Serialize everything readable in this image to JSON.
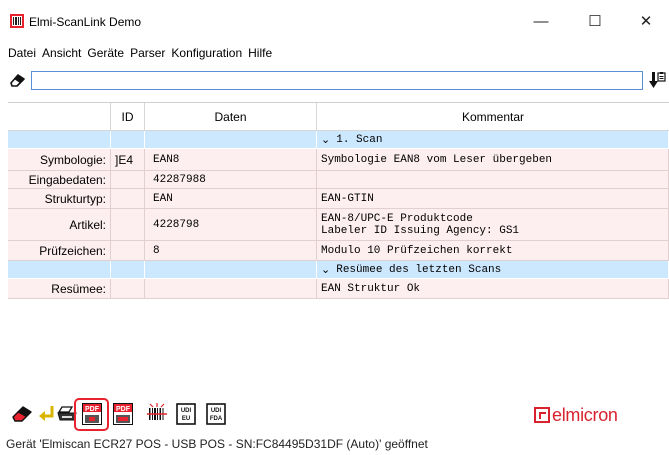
{
  "window": {
    "title": "Elmi-ScanLink Demo",
    "controls": {
      "minimize": "—",
      "maximize": "☐",
      "close": "✕"
    }
  },
  "menu": [
    "Datei",
    "Ansicht",
    "Geräte",
    "Parser",
    "Konfiguration",
    "Hilfe"
  ],
  "search": {
    "value": "",
    "placeholder": ""
  },
  "table": {
    "columns": [
      "",
      "ID",
      "Daten",
      "Kommentar"
    ],
    "rows": [
      {
        "kind": "section",
        "label": "",
        "id": "",
        "data": "",
        "comment": "1. Scan"
      },
      {
        "kind": "data",
        "label": "Symbologie:",
        "id": "]E4",
        "data": "EAN8",
        "comment": "Symbologie EAN8 vom Leser übergeben"
      },
      {
        "kind": "data",
        "label": "Eingabedaten:",
        "id": "",
        "data": "42287988",
        "comment": ""
      },
      {
        "kind": "data",
        "label": "Strukturtyp:",
        "id": "",
        "data": "EAN",
        "comment": "EAN-GTIN"
      },
      {
        "kind": "data",
        "label": "Artikel:",
        "id": "",
        "data": "4228798",
        "comment": "EAN-8/UPC-E Produktcode\nLabeler ID Issuing Agency: GS1"
      },
      {
        "kind": "data",
        "label": "Prüfzeichen:",
        "id": "",
        "data": "8",
        "comment": "Modulo 10 Prüfzeichen korrekt"
      },
      {
        "kind": "section",
        "label": "",
        "id": "",
        "data": "",
        "comment": "Resümee des letzten Scans"
      },
      {
        "kind": "data",
        "label": "Resümee:",
        "id": "",
        "data": "",
        "comment": "EAN Struktur Ok"
      }
    ]
  },
  "toolbar": {
    "pdf_label": "PDF",
    "udi_eu_label": "UDI\nEU",
    "udi_fda_label": "UDI\nFDA"
  },
  "logo": {
    "text": "elmicron"
  },
  "status": {
    "text": "Gerät 'Elmiscan ECR27 POS - USB POS - SN:FC84495D31DF (Auto)' geöffnet"
  },
  "colors": {
    "selection_blue": "#cce8ff",
    "row_pink": "#fdeef0",
    "brand_red": "#d8232f",
    "highlight_red": "#e8232f"
  }
}
